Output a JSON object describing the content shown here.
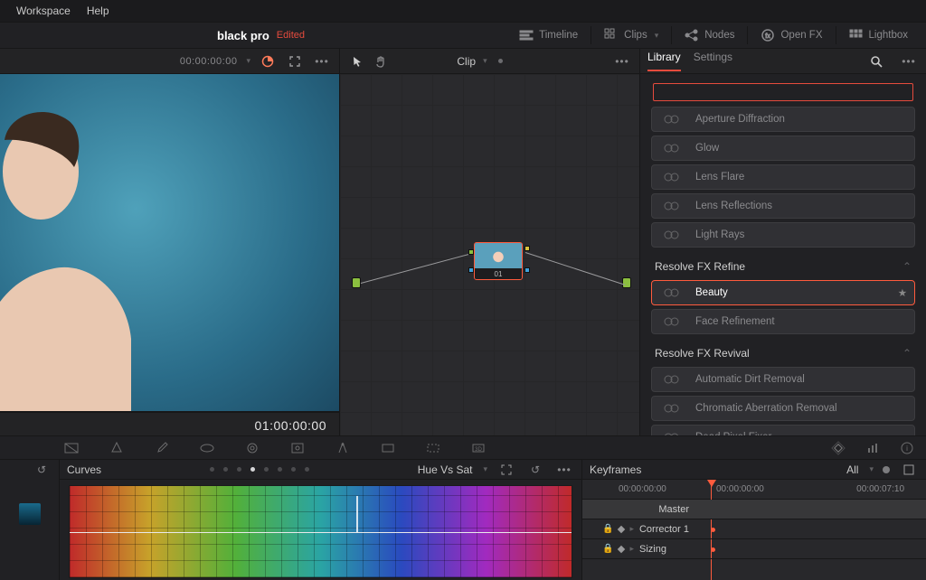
{
  "menu": {
    "workspace": "Workspace",
    "help": "Help"
  },
  "project": {
    "name": "black pro",
    "status": "Edited"
  },
  "toolbar": {
    "timeline": "Timeline",
    "clips": "Clips",
    "nodes": "Nodes",
    "openfx": "Open FX",
    "lightbox": "Lightbox"
  },
  "viewer": {
    "tc_in": "00:00:00:00",
    "tc_out": "01:00:00:00"
  },
  "nodes": {
    "scope": "Clip",
    "node_label": "01"
  },
  "fx": {
    "tabs": {
      "library": "Library",
      "settings": "Settings"
    },
    "search_placeholder": "",
    "groups": [
      {
        "title": null,
        "items": [
          {
            "label": "Aperture Diffraction",
            "selected": false
          },
          {
            "label": "Glow",
            "selected": false
          },
          {
            "label": "Lens Flare",
            "selected": false
          },
          {
            "label": "Lens Reflections",
            "selected": false
          },
          {
            "label": "Light Rays",
            "selected": false
          }
        ]
      },
      {
        "title": "Resolve FX Refine",
        "items": [
          {
            "label": "Beauty",
            "selected": true,
            "fav": true
          },
          {
            "label": "Face Refinement",
            "selected": false
          }
        ]
      },
      {
        "title": "Resolve FX Revival",
        "items": [
          {
            "label": "Automatic Dirt Removal",
            "selected": false
          },
          {
            "label": "Chromatic Aberration Removal",
            "selected": false
          },
          {
            "label": "Dead Pixel Fixer",
            "selected": false
          }
        ]
      }
    ]
  },
  "curves": {
    "title": "Curves",
    "mode": "Hue Vs Sat"
  },
  "keyframes": {
    "title": "Keyframes",
    "filter": "All",
    "time0": "00:00:00:00",
    "time1": "00:00:00:00",
    "time2": "00:00:07:10",
    "rows": {
      "master": "Master",
      "corrector": "Corrector 1",
      "sizing": "Sizing"
    }
  }
}
